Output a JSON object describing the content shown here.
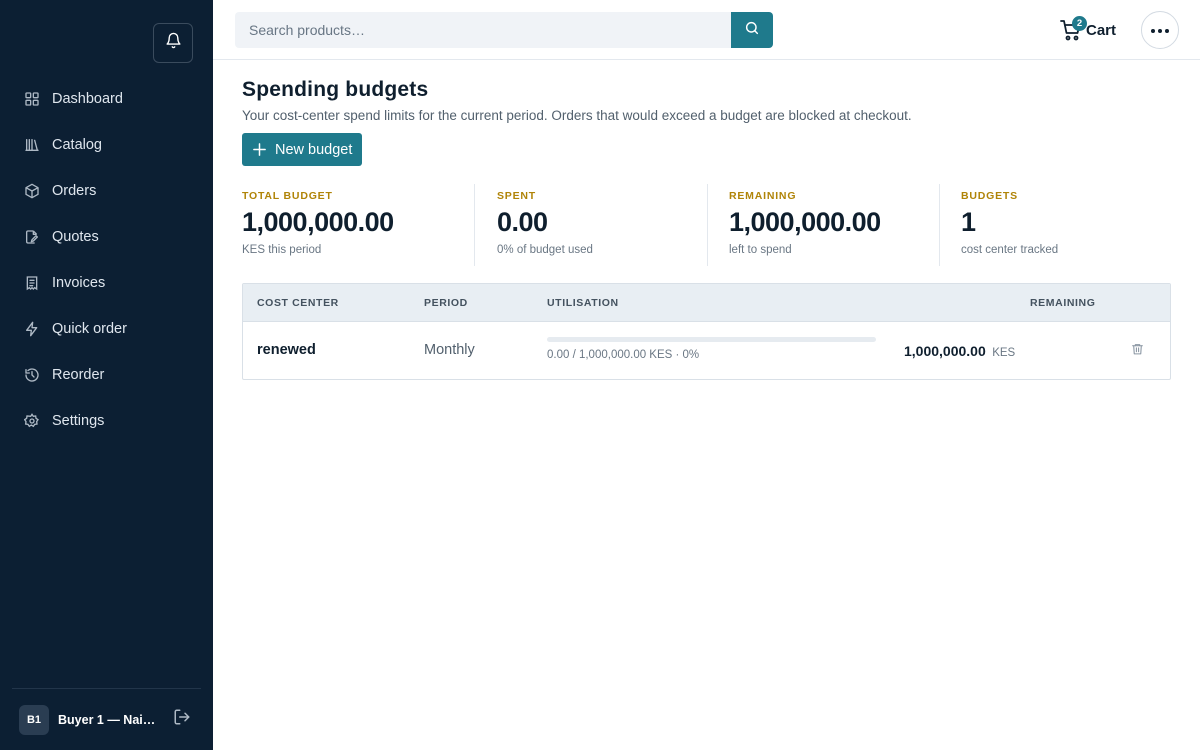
{
  "sidebar": {
    "items": [
      {
        "label": "Dashboard",
        "icon": "dashboard-icon"
      },
      {
        "label": "Catalog",
        "icon": "catalog-icon"
      },
      {
        "label": "Orders",
        "icon": "box-icon"
      },
      {
        "label": "Quotes",
        "icon": "quote-icon"
      },
      {
        "label": "Invoices",
        "icon": "invoice-icon"
      },
      {
        "label": "Quick order",
        "icon": "lightning-icon"
      },
      {
        "label": "Reorder",
        "icon": "history-icon"
      },
      {
        "label": "Settings",
        "icon": "gear-icon"
      }
    ],
    "user": {
      "initials": "B1",
      "name": "Buyer 1 — Nair…"
    }
  },
  "topbar": {
    "search_placeholder": "Search products…",
    "cart": {
      "count": "2",
      "label": "Cart"
    }
  },
  "page": {
    "title": "Spending budgets",
    "subtitle": "Your cost-center spend limits for the current period. Orders that would exceed a budget are blocked at checkout.",
    "new_button": "New budget"
  },
  "stats": [
    {
      "label": "TOTAL BUDGET",
      "value": "1,000,000.00",
      "sub": "KES this period"
    },
    {
      "label": "SPENT",
      "value": "0.00",
      "sub": "0% of budget used"
    },
    {
      "label": "REMAINING",
      "value": "1,000,000.00",
      "sub": "left to spend"
    },
    {
      "label": "BUDGETS",
      "value": "1",
      "sub": "cost center tracked"
    }
  ],
  "table": {
    "headers": {
      "cost_center": "COST CENTER",
      "period": "PERIOD",
      "utilisation": "UTILISATION",
      "remaining": "REMAINING"
    },
    "rows": [
      {
        "cost_center": "renewed",
        "period": "Monthly",
        "utilisation_fraction": 0,
        "utilisation_text": "0.00 / 1,000,000.00 KES · 0%",
        "remaining": "1,000,000.00",
        "currency": "KES"
      }
    ]
  },
  "colors": {
    "sidebar_bg": "#0c1f33",
    "accent": "#1f7a8c",
    "stat_label": "#b08408"
  }
}
